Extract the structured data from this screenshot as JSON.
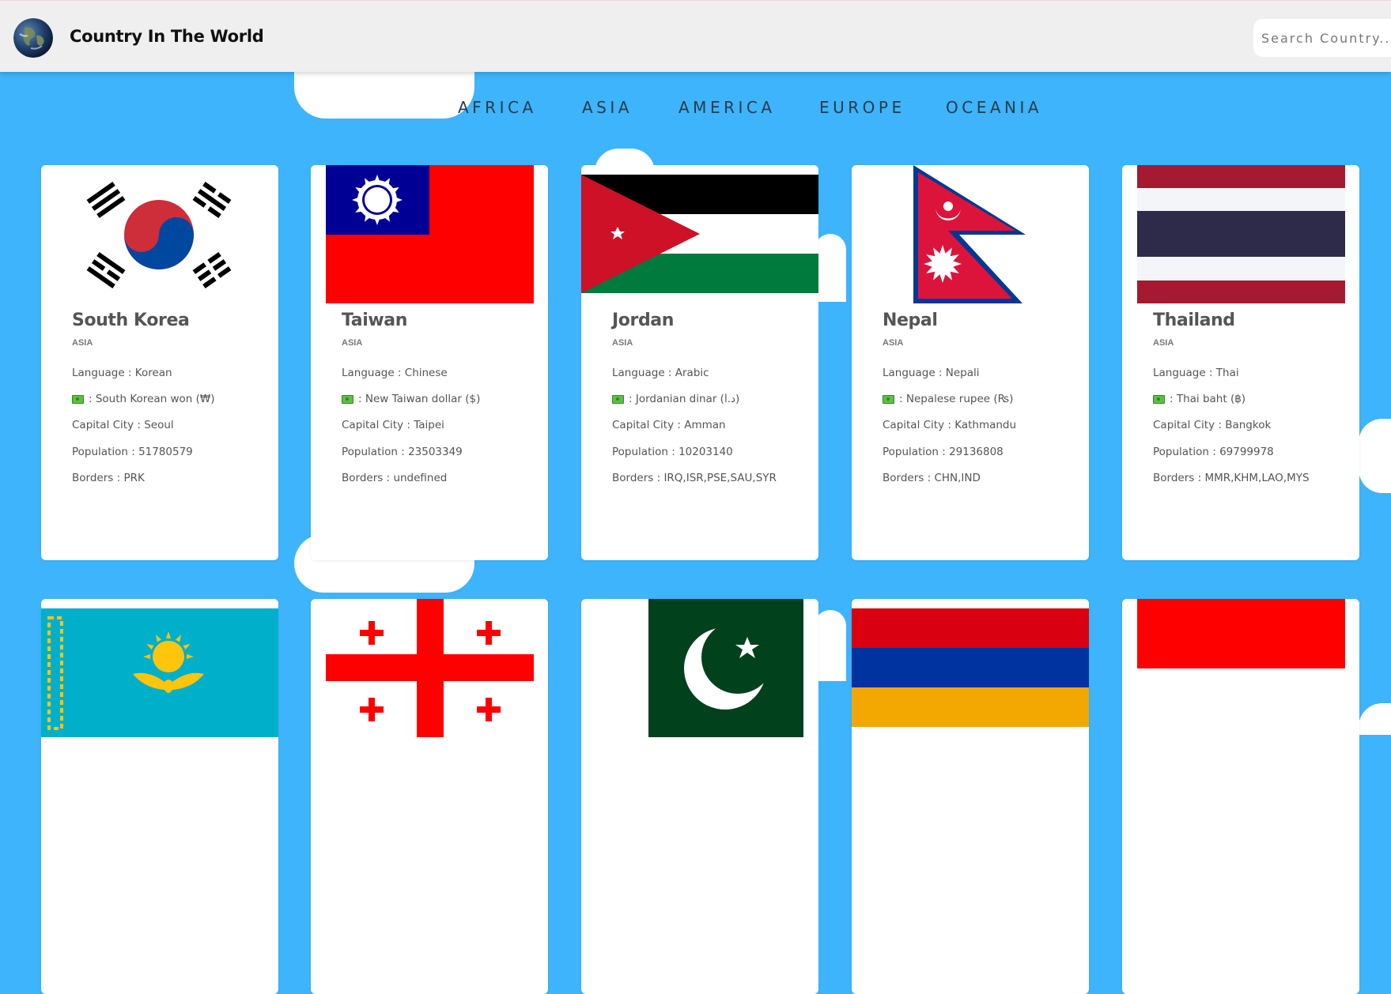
{
  "header": {
    "title": "Country In The World",
    "search_placeholder": "Search Country..."
  },
  "nav": [
    "AFRICA",
    "ASIA",
    "AMERICA",
    "EUROPE",
    "OCEANIA"
  ],
  "labels": {
    "language": "Language : ",
    "currency_sep": ": ",
    "capital": "Capital City : ",
    "population": "Population : ",
    "borders": "Borders : "
  },
  "countries": [
    {
      "name": "South Korea",
      "region": "ASIA",
      "language": "Korean",
      "currency": "South Korean won (₩)",
      "capital": "Seoul",
      "population": "51780579",
      "borders": "PRK",
      "flag_icon": "south-korea-flag"
    },
    {
      "name": "Taiwan",
      "region": "ASIA",
      "language": "Chinese",
      "currency": "New Taiwan dollar ($)",
      "capital": "Taipei",
      "population": "23503349",
      "borders": "undefined",
      "flag_icon": "taiwan-flag"
    },
    {
      "name": "Jordan",
      "region": "ASIA",
      "language": "Arabic",
      "currency": "Jordanian dinar (د.ا)",
      "capital": "Amman",
      "population": "10203140",
      "borders": "IRQ,ISR,PSE,SAU,SYR",
      "flag_icon": "jordan-flag"
    },
    {
      "name": "Nepal",
      "region": "ASIA",
      "language": "Nepali",
      "currency": "Nepalese rupee (₨)",
      "capital": "Kathmandu",
      "population": "29136808",
      "borders": "CHN,IND",
      "flag_icon": "nepal-flag"
    },
    {
      "name": "Thailand",
      "region": "ASIA",
      "language": "Thai",
      "currency": "Thai baht (฿)",
      "capital": "Bangkok",
      "population": "69799978",
      "borders": "MMR,KHM,LAO,MYS",
      "flag_icon": "thailand-flag"
    }
  ],
  "second_row_flags": [
    "kazakhstan-flag",
    "georgia-flag",
    "pakistan-flag",
    "armenia-flag",
    "indonesia-flag"
  ],
  "colors": {
    "background": "#3db4fb",
    "header": "#efefef",
    "card": "#ffffff",
    "nav_text": "#2b3a4a",
    "heading": "#555555"
  }
}
